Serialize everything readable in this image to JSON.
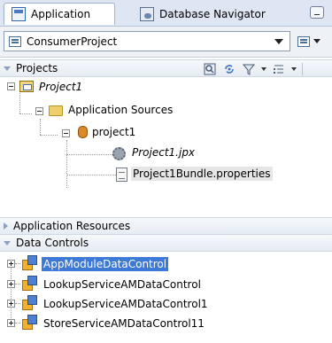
{
  "tabs": [
    {
      "label": "Application",
      "active": true,
      "icon": "application-icon"
    },
    {
      "label": "Database Navigator",
      "active": false,
      "icon": "database-navigator-icon"
    }
  ],
  "project_selector": {
    "value": "ConsumerProject",
    "icon": "project-combo-icon"
  },
  "sections": {
    "projects": "Projects",
    "application_resources": "Application Resources",
    "data_controls": "Data Controls"
  },
  "project_tree": [
    {
      "label": "Project1",
      "icon": "project-icon",
      "italic": true
    },
    {
      "label": "Application Sources",
      "icon": "folder-icon"
    },
    {
      "label": "project1",
      "icon": "package-icon"
    },
    {
      "label": "Project1.jpx",
      "icon": "gear-icon",
      "italic": true
    },
    {
      "label": "Project1Bundle.properties",
      "icon": "properties-file-icon",
      "highlighted": true
    }
  ],
  "data_controls": [
    {
      "label": "AppModuleDataControl",
      "selected": true
    },
    {
      "label": "LookupServiceAMDataControl"
    },
    {
      "label": "LookupServiceAMDataControl1"
    },
    {
      "label": "StoreServiceAMDataControl11"
    }
  ],
  "colors": {
    "selection": "#3d79d6",
    "tab_bar": "#dde6f2",
    "section_header": "#e6ecf3"
  }
}
